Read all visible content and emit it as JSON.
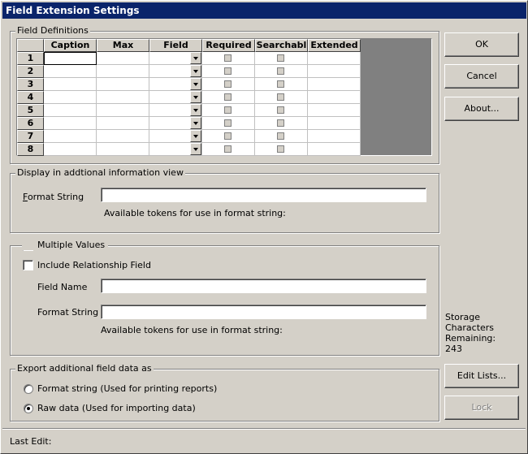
{
  "window": {
    "title": "Field Extension Settings"
  },
  "field_definitions": {
    "label": "Field Definitions",
    "columns": [
      "Caption",
      "Max",
      "Field",
      "Required",
      "Searchabl",
      "Extended"
    ],
    "rows": [
      "1",
      "2",
      "3",
      "4",
      "5",
      "6",
      "7",
      "8"
    ]
  },
  "display_group": {
    "label": "Display in addtional information view",
    "format_label": "Format String",
    "format_value": "",
    "tokens_text": "Available tokens for use in format string:"
  },
  "multi_group": {
    "multiple_values_label": "Multiple Values",
    "include_relationship_label": "Include Relationship Field",
    "field_name_label": "Field Name",
    "field_name_value": "",
    "format_label": "Format String",
    "format_value": "",
    "tokens_text": "Available tokens for use in format string:"
  },
  "export_group": {
    "label": "Export additional field data as",
    "option_format": "Format string (Used for printing reports)",
    "option_raw": "Raw data (Used for importing data)",
    "selected": "raw"
  },
  "buttons": {
    "ok": "OK",
    "cancel": "Cancel",
    "about": "About...",
    "edit_lists": "Edit Lists...",
    "lock": "Lock"
  },
  "storage": {
    "line1": "Storage",
    "line2": "Characters",
    "line3": "Remaining:",
    "value": "243"
  },
  "status": {
    "last_edit": "Last Edit:"
  }
}
